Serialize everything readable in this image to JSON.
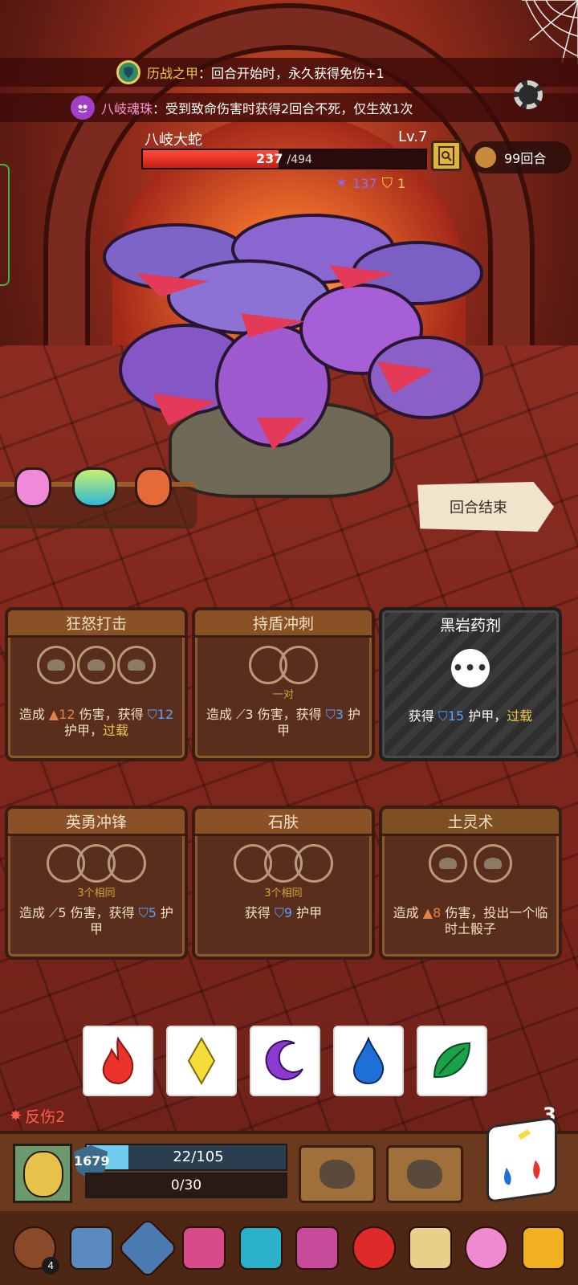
{
  "buffs": [
    {
      "name": "历战之甲",
      "sep": "：",
      "text": "回合开始时，永久获得免伤+1"
    },
    {
      "name": "八岐魂珠",
      "sep": "：",
      "text": "受到致命伤害时获得2回合不死，仅生效1次"
    }
  ],
  "boss": {
    "name": "八岐大蛇",
    "level": "Lv.7",
    "hp_current": "237",
    "hp_max": "/494",
    "hp_fraction": 0.48,
    "intent_attack": "137",
    "intent_shield": "1"
  },
  "turns_label": "99回合",
  "end_turn_label": "回合结束",
  "cards": [
    {
      "title": "狂怒打击",
      "req": "",
      "desc_parts": [
        "造成 ",
        "12",
        " 伤害，获得 ",
        "12",
        " 护甲，",
        "过载"
      ]
    },
    {
      "title": "持盾冲刺",
      "req": "一对",
      "desc_parts": [
        "造成 ",
        "3",
        " 伤害，获得 ",
        "3",
        " 护甲"
      ]
    },
    {
      "title": "黑岩药剂",
      "req": "",
      "desc_parts": [
        "获得 ",
        "15",
        " 护甲，",
        "过载"
      ]
    },
    {
      "title": "英勇冲锋",
      "req": "3个相同",
      "desc_parts": [
        "造成 ",
        "5",
        " 伤害，获得 ",
        "5",
        " 护甲"
      ]
    },
    {
      "title": "石肤",
      "req": "3个相同",
      "desc_parts": [
        "获得 ",
        "9",
        " 护甲"
      ]
    },
    {
      "title": "土灵术",
      "req": "",
      "desc_parts": [
        "造成 ",
        "8",
        " 伤害，投出一个临时土骰子"
      ]
    }
  ],
  "dice_faces": [
    {
      "icon": "fire-icon",
      "color": "#e8322a"
    },
    {
      "icon": "diamond-icon",
      "color": "#f5dc3a"
    },
    {
      "icon": "moon-icon",
      "color": "#8a3ad0"
    },
    {
      "icon": "water-drop-icon",
      "color": "#1f6fd8"
    },
    {
      "icon": "leaf-icon",
      "color": "#1aa24a"
    }
  ],
  "player": {
    "reflect_label": "反伤2",
    "dice_count": "3",
    "armor": "1679",
    "hp": "22/105",
    "hp_fraction": 0.21,
    "xp": "0/30"
  },
  "relic_badge": "4",
  "colors": {
    "hp_red": "#e0281c",
    "accent_gold": "#f2c94c",
    "armor_blue": "#5aa0ff"
  }
}
